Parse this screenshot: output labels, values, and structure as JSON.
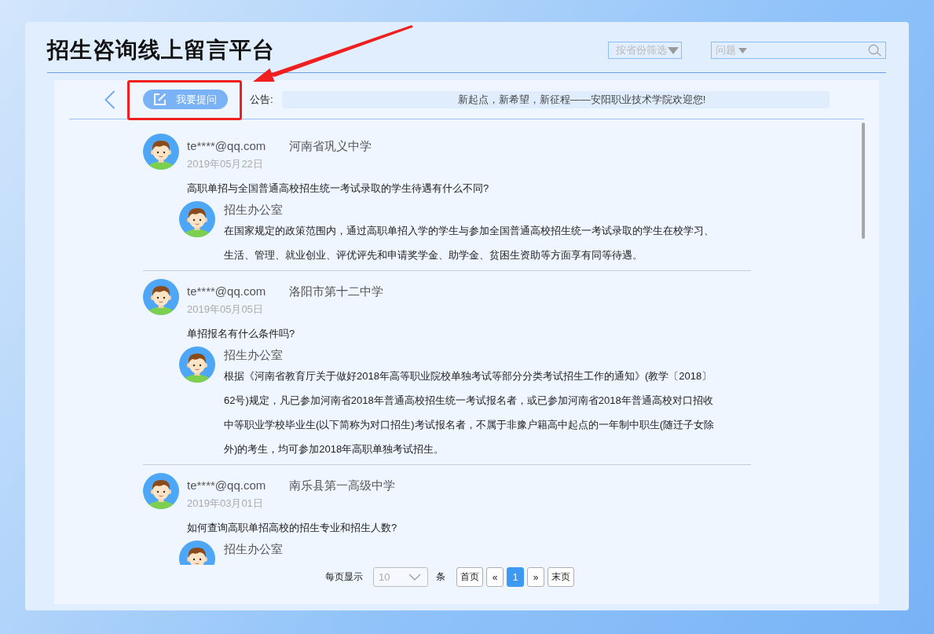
{
  "header": {
    "title": "招生咨询线上留言平台",
    "province_filter": {
      "label": "按省份筛选"
    },
    "search": {
      "category": "问题"
    }
  },
  "toolbar": {
    "ask_button": {
      "label": "我要提问",
      "highlighted": true
    },
    "notice_label": "公告:",
    "notice": "新起点，新希望，新征程——安阳职业技术学院欢迎您!"
  },
  "posts": [
    {
      "user": "te****@qq.com",
      "school": "河南省巩义中学",
      "date": "2019年05月22日",
      "question": "高职单招与全国普通高校招生统一考试录取的学生待遇有什么不同?",
      "reply": {
        "author": "招生办公室",
        "text": "在国家规定的政策范围内，通过高职单招入学的学生与参加全国普通高校招生统一考试录取的学生在校学习、生活、管理、就业创业、评优评先和申请奖学金、助学金、贫困生资助等方面享有同等待遇。"
      }
    },
    {
      "user": "te****@qq.com",
      "school": "洛阳市第十二中学",
      "date": "2019年05月05日",
      "question": "单招报名有什么条件吗?",
      "reply": {
        "author": "招生办公室",
        "text": "根据《河南省教育厅关于做好2018年高等职业院校单独考试等部分分类考试招生工作的通知》(教学〔2018〕62号)规定，凡已参加河南省2018年普通高校招生统一考试报名者，或已参加河南省2018年普通高校对口招收中等职业学校毕业生(以下简称为对口招生)考试报名者，不属于非豫户籍高中起点的一年制中职生(随迁子女除外)的考生，均可参加2018年高职单独考试招生。"
      }
    },
    {
      "user": "te****@qq.com",
      "school": "南乐县第一高级中学",
      "date": "2019年03月01日",
      "question": "如何查询高职单招高校的招生专业和招生人数?",
      "reply": {
        "author": "招生办公室"
      }
    }
  ],
  "pagination": {
    "per_page_label": "每页显示",
    "page_size": "10",
    "unit": "条",
    "first": "首页",
    "prev": "«",
    "pages": [
      {
        "label": "1",
        "selected": true
      }
    ],
    "next": "»",
    "last": "末页"
  }
}
